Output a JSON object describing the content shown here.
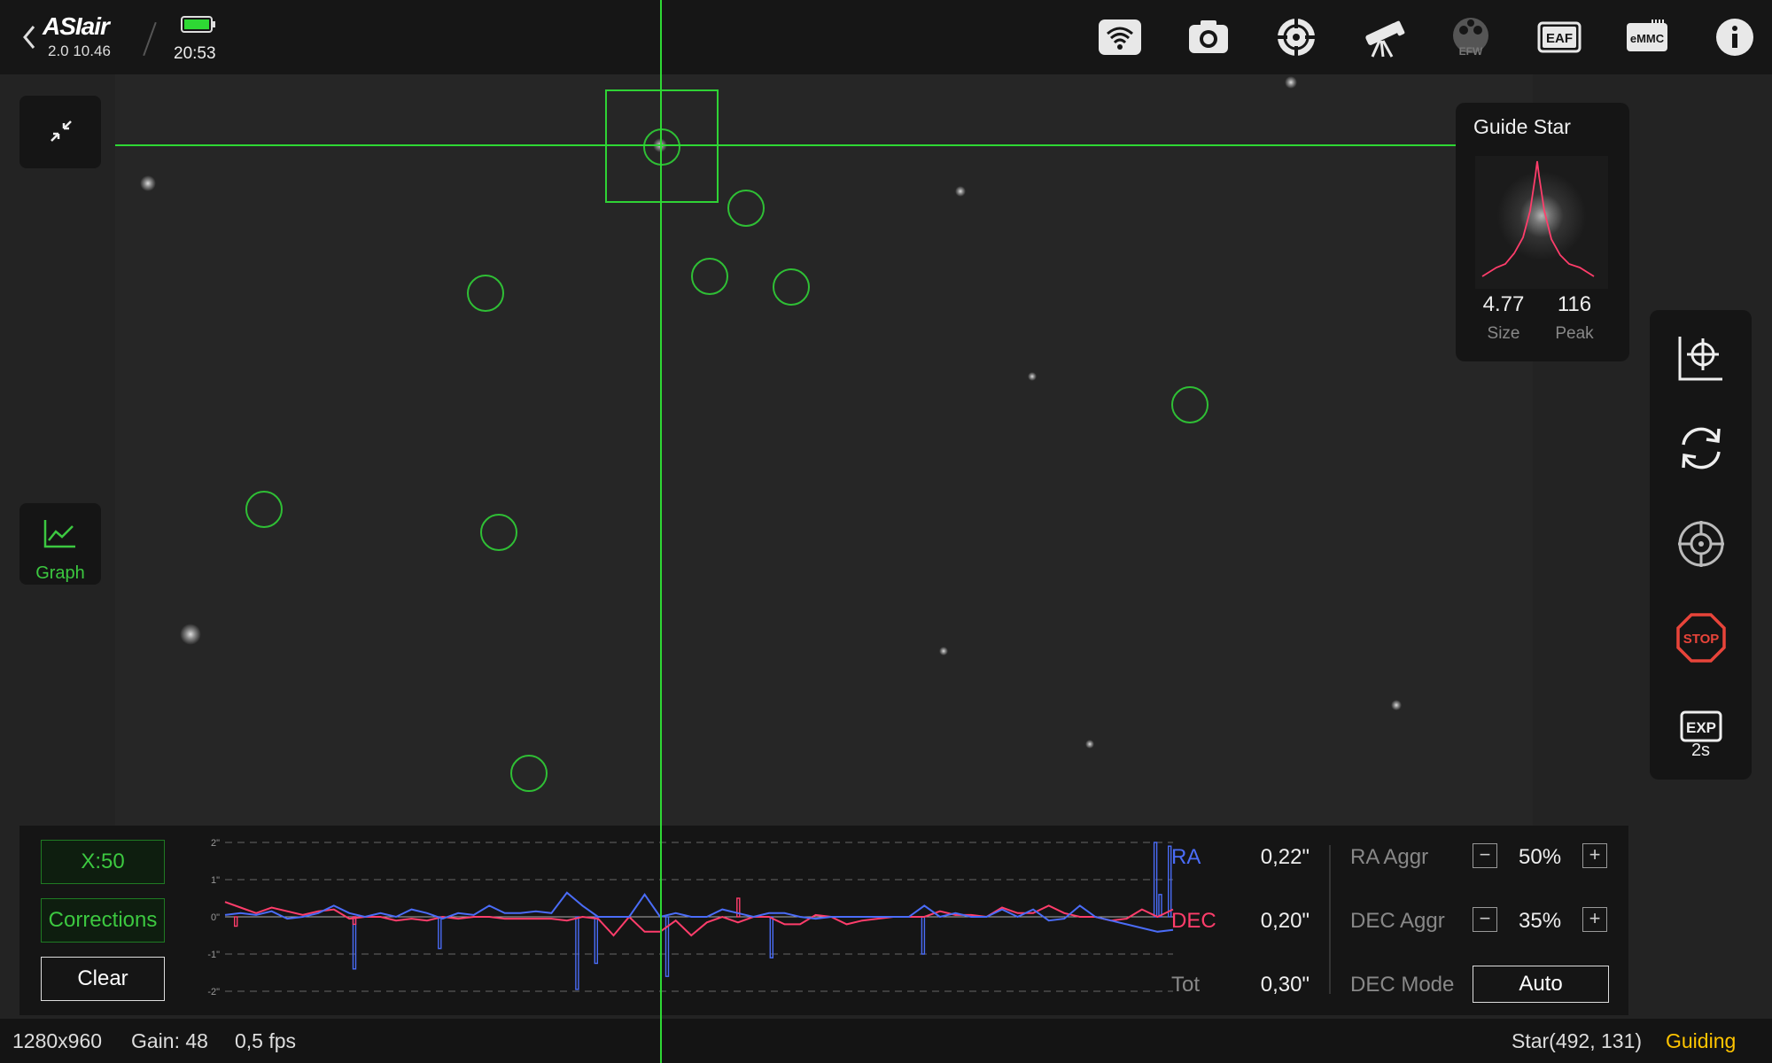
{
  "header": {
    "brand": "ASIair",
    "version": "2.0 10.46",
    "time": "20:53",
    "battery_level": 0.95,
    "icons": [
      "wifi-icon",
      "camera-icon",
      "guide-icon",
      "telescope-icon",
      "efw-icon",
      "eaf-icon",
      "emmc-icon",
      "info-icon"
    ],
    "efw_label": "EFW",
    "eaf_label": "EAF",
    "emmc_label": "eMMC",
    "accent": "#2ed834"
  },
  "left": {
    "collapse_icon": "collapse-icon",
    "graph_label": "Graph"
  },
  "guide_star": {
    "title": "Guide Star",
    "size_value": "4.77",
    "size_label": "Size",
    "peak_value": "116",
    "peak_label": "Peak"
  },
  "right_toolbar": {
    "icons": [
      "calibrate-icon",
      "refresh-icon",
      "target-icon",
      "stop-icon",
      "exp-icon"
    ],
    "stop_label": "STOP",
    "exp_label": "EXP",
    "exp_value": "2s",
    "stop_color": "#e8443a"
  },
  "graph_panel": {
    "x_button": "X:50",
    "corrections_button": "Corrections",
    "clear_button": "Clear",
    "y_ticks": [
      "2\"",
      "1\"",
      "0\"",
      "-1\"",
      "-2\""
    ],
    "ra_label": "RA",
    "ra_value": "0,22\"",
    "dec_label": "DEC",
    "dec_value": "0,20\"",
    "tot_label": "Tot",
    "tot_value": "0,30\"",
    "ra_aggr_label": "RA Aggr",
    "ra_aggr_value": "50%",
    "dec_aggr_label": "DEC Aggr",
    "dec_aggr_value": "35%",
    "dec_mode_label": "DEC Mode",
    "dec_mode_value": "Auto",
    "minus": "−",
    "plus": "+",
    "ra_color": "#4a6cf7",
    "dec_color": "#ff3d6b"
  },
  "status_bar": {
    "resolution": "1280x960",
    "gain": "Gain: 48",
    "fps": "0,5 fps",
    "star": "Star(492, 131)",
    "state": "Guiding",
    "state_color": "#ffc400"
  }
}
